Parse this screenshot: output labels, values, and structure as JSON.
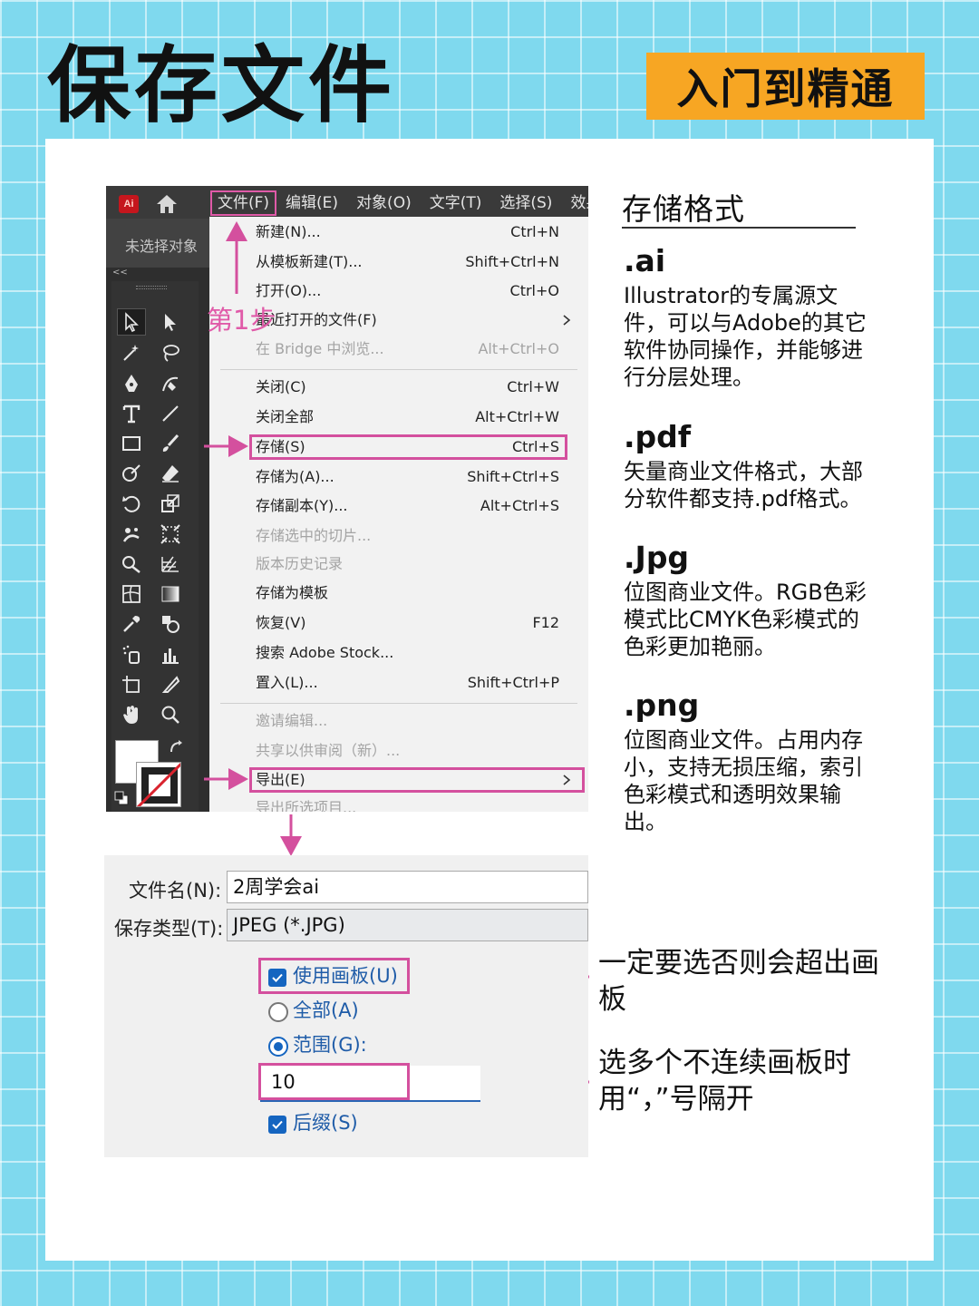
{
  "header": {
    "title": "保存文件",
    "badge": "入门到精通"
  },
  "app": {
    "logo_text": "Ai",
    "menu": [
      "文件(F)",
      "编辑(E)",
      "对象(O)",
      "文字(T)",
      "选择(S)",
      "效果"
    ],
    "no_selection": "未选择对象",
    "collapse_glyph": "<<"
  },
  "file_menu": {
    "items": [
      {
        "label": "新建(N)...",
        "shortcut": "Ctrl+N",
        "disabled": false
      },
      {
        "label": "从模板新建(T)...",
        "shortcut": "Shift+Ctrl+N",
        "disabled": false
      },
      {
        "label": "打开(O)...",
        "shortcut": "Ctrl+O",
        "disabled": false
      },
      {
        "label": "最近打开的文件(F)",
        "shortcut": "",
        "disabled": false,
        "submenu": true
      },
      {
        "label": "在 Bridge 中浏览...",
        "shortcut": "Alt+Ctrl+O",
        "disabled": true
      },
      {
        "label": "关闭(C)",
        "shortcut": "Ctrl+W",
        "disabled": false
      },
      {
        "label": "关闭全部",
        "shortcut": "Alt+Ctrl+W",
        "disabled": false
      },
      {
        "label": "存储(S)",
        "shortcut": "Ctrl+S",
        "disabled": false
      },
      {
        "label": "存储为(A)...",
        "shortcut": "Shift+Ctrl+S",
        "disabled": false
      },
      {
        "label": "存储副本(Y)...",
        "shortcut": "Alt+Ctrl+S",
        "disabled": false
      },
      {
        "label": "存储选中的切片...",
        "shortcut": "",
        "disabled": true
      },
      {
        "label": "版本历史记录",
        "shortcut": "",
        "disabled": true
      },
      {
        "label": "存储为模板",
        "shortcut": "",
        "disabled": false
      },
      {
        "label": "恢复(V)",
        "shortcut": "F12",
        "disabled": false
      },
      {
        "label": "搜索 Adobe Stock...",
        "shortcut": "",
        "disabled": false
      },
      {
        "label": "置入(L)...",
        "shortcut": "Shift+Ctrl+P",
        "disabled": false
      },
      {
        "label": "邀请编辑...",
        "shortcut": "",
        "disabled": true
      },
      {
        "label": "共享以供审阅（新）...",
        "shortcut": "",
        "disabled": true
      },
      {
        "label": "导出(E)",
        "shortcut": "",
        "disabled": false,
        "submenu": true
      },
      {
        "label": "导出所选项目...",
        "shortcut": "",
        "disabled": true
      }
    ]
  },
  "annotation": {
    "step1": "第1步"
  },
  "dialog": {
    "filename_label": "文件名(N):",
    "filename_value": "2周学会ai",
    "type_label": "保存类型(T):",
    "type_value": "JPEG (*.JPG)",
    "use_artboards": "使用画板(U)",
    "all": "全部(A)",
    "range": "范围(G):",
    "range_value": "10",
    "suffix": "后缀(S)"
  },
  "formats": {
    "title": "存储格式",
    "items": [
      {
        "name": ".ai",
        "desc": "Illustrator的专属源文件，可以与Adobe的其它软件协同操作，并能够进行分层处理。"
      },
      {
        "name": ".pdf",
        "desc": "矢量商业文件格式，大部分软件都支持.pdf格式。"
      },
      {
        "name": ".Jpg",
        "desc": "位图商业文件。RGB色彩模式比CMYK色彩模式的色彩更加艳丽。"
      },
      {
        "name": ".png",
        "desc": "位图商业文件。占用内存小，支持无损压缩，索引色彩模式和透明效果输出。"
      }
    ]
  },
  "notes": {
    "artboard": "一定要选否则会超出画板",
    "range": "选多个不连续画板时用“，”号隔开"
  },
  "colors": {
    "accent": "#d4509e",
    "badge": "#f7a623",
    "background": "#7fd9ee",
    "dialog_blue": "#1565c0"
  }
}
